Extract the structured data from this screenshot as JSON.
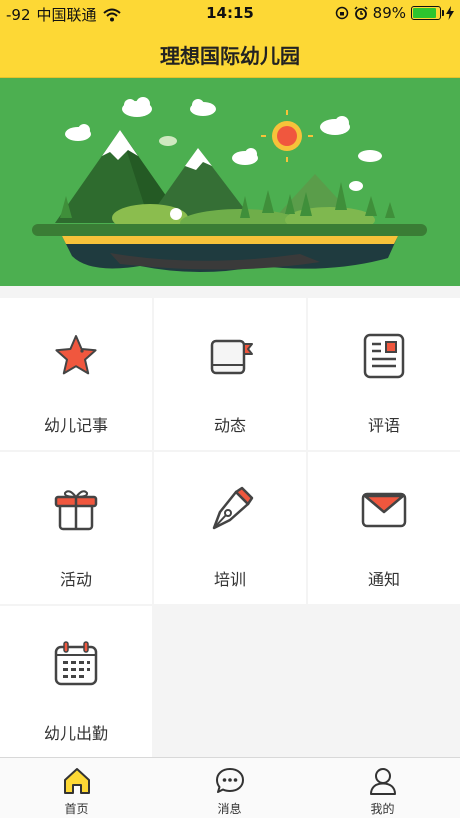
{
  "status_bar": {
    "signal": "-92",
    "carrier": "中国联通",
    "time": "14:15",
    "battery_percent": "89%",
    "battery_level": 0.89
  },
  "nav": {
    "title": "理想国际幼儿园"
  },
  "colors": {
    "brand_yellow": "#fdd835",
    "banner_green": "#4caf50",
    "accent_red": "#f0573e"
  },
  "menu": [
    {
      "label": "幼儿记事",
      "icon": "star-icon"
    },
    {
      "label": "动态",
      "icon": "book-icon"
    },
    {
      "label": "评语",
      "icon": "document-icon"
    },
    {
      "label": "活动",
      "icon": "gift-icon"
    },
    {
      "label": "培训",
      "icon": "pen-icon"
    },
    {
      "label": "通知",
      "icon": "envelope-icon"
    },
    {
      "label": "幼儿出勤",
      "icon": "calendar-icon"
    }
  ],
  "tabbar": [
    {
      "label": "首页",
      "icon": "home-icon",
      "active": true
    },
    {
      "label": "消息",
      "icon": "message-icon",
      "active": false
    },
    {
      "label": "我的",
      "icon": "user-icon",
      "active": false
    }
  ]
}
